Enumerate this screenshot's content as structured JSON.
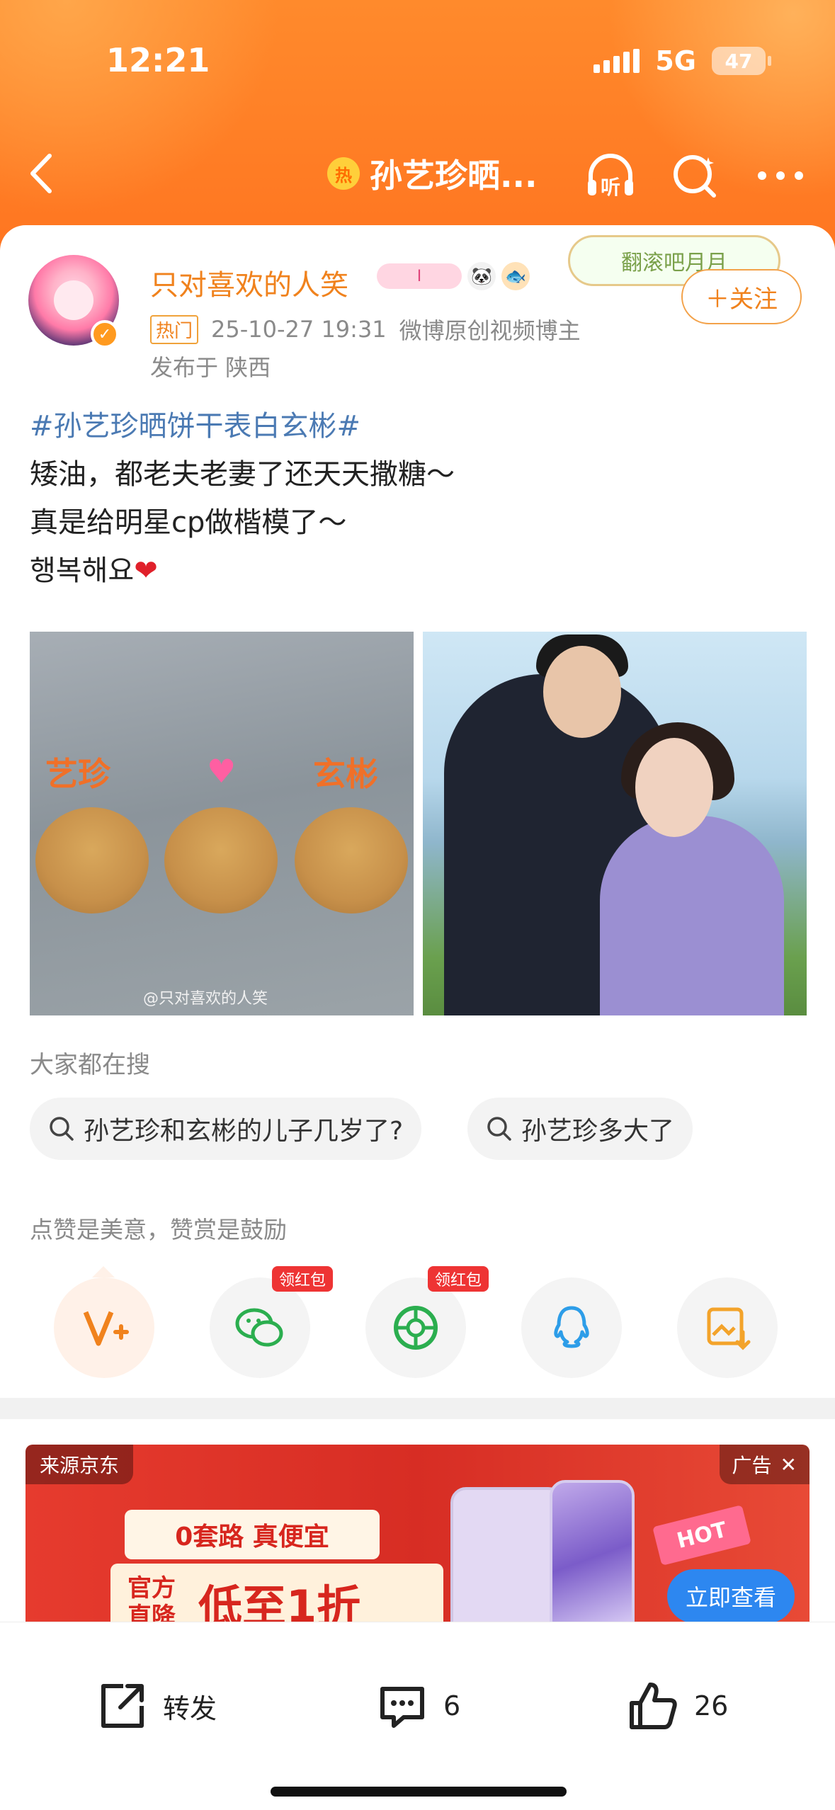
{
  "status_bar": {
    "time": "12:21",
    "network": "5G",
    "battery": "47"
  },
  "nav": {
    "hot_badge": "热",
    "title": "孙艺珍晒...",
    "listen_label": "听"
  },
  "post": {
    "author": "只对喜欢的人笑",
    "emblem_text": "I",
    "sticker_text": "翻滚吧月月",
    "follow_label": "＋关注",
    "hot_tag": "热门",
    "time": "25-10-27 19:31",
    "source": "微博原创视频博主",
    "location": "发布于 陕西",
    "hashtag": "#孙艺珍晒饼干表白玄彬#",
    "lines": [
      "矮油，都老夫老妻了还天天撒糖～",
      "真是给明星cp做楷模了～",
      "행복해요"
    ],
    "heart": "❤",
    "photo_left": {
      "label_left": "艺珍",
      "label_right": "玄彬",
      "watermark": "@只对喜欢的人笑"
    }
  },
  "searches": {
    "title": "大家都在搜",
    "chips": [
      "孙艺珍和玄彬的儿子几岁了?",
      "孙艺珍多大了"
    ]
  },
  "appreciate": {
    "text": "点赞是美意，赞赏是鼓励",
    "red_tag": "领红包",
    "colors": {
      "vplus": "#f0821d",
      "wechat": "#2bae4f",
      "moments": "#2bae4f",
      "qq": "#2d9de8",
      "save": "#f3a32a"
    }
  },
  "ad": {
    "source": "来源京东",
    "tag": "广告",
    "slogan": "0套路 真便宜",
    "box_small": "官方直降",
    "box_big": "低至1折",
    "hot": "HOT",
    "cta": "立即查看"
  },
  "actions": {
    "repost": "转发",
    "comments": "6",
    "likes": "26"
  }
}
